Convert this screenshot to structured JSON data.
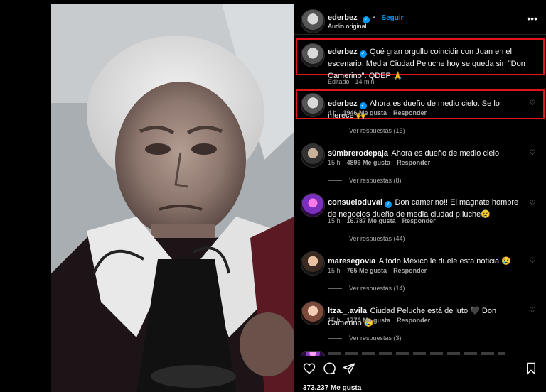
{
  "post": {
    "username": "ederbez",
    "follow_label": "Seguir",
    "audio": "Audio original",
    "more_icon": "more-icon"
  },
  "caption": {
    "username": "ederbez",
    "text": "Qué gran orgullo coincidir con Juan en el escenario. Media Ciudad Peluche hoy se queda sin \"Don Camerino\". QDEP 🙏",
    "edited": "Editado · 14 min"
  },
  "comments": [
    {
      "username": "ederbez",
      "verified": true,
      "text": "Ahora es dueño de medio cielo. Se lo merece 🙌",
      "time": "4 h",
      "likes": "1946 Me gusta",
      "reply": "Responder",
      "view_replies": "Ver respuestas (13)"
    },
    {
      "username": "s0mbrerodepaja",
      "verified": false,
      "text": "Ahora es dueño de medio cielo",
      "time": "15 h",
      "likes": "4899 Me gusta",
      "reply": "Responder",
      "view_replies": "Ver respuestas (8)"
    },
    {
      "username": "consueloduval",
      "verified": true,
      "text": "Don camerino!! El magnate hombre de negocios dueño de media ciudad p.luche😢",
      "time": "15 h",
      "likes": "16.787 Me gusta",
      "reply": "Responder",
      "view_replies": "Ver respuestas (44)"
    },
    {
      "username": "maresegovia",
      "verified": false,
      "text": "A todo México le duele esta noticia 😢",
      "time": "15 h",
      "likes": "765 Me gusta",
      "reply": "Responder",
      "view_replies": "Ver respuestas (14)"
    },
    {
      "username": "ltza._.avila",
      "verified": false,
      "text": "Ciudad Peluche está de luto 🖤 Don Camerino 😢",
      "time": "15 h",
      "likes": "1775 Me gusta",
      "reply": "Responder",
      "view_replies": "Ver respuestas (3)"
    }
  ],
  "footer": {
    "likes": "373.237 Me gusta"
  },
  "colors": {
    "accent": "#0095f6",
    "highlight": "#e2141c",
    "background": "#000000"
  }
}
